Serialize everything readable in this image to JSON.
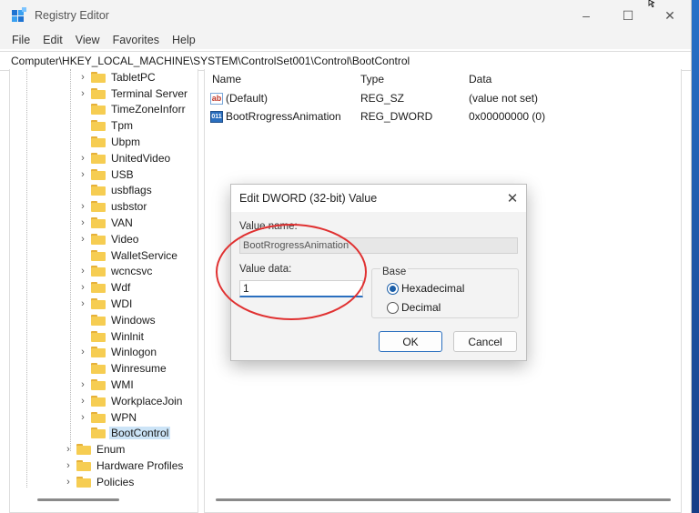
{
  "window": {
    "title": "Registry Editor"
  },
  "menu": [
    "File",
    "Edit",
    "View",
    "Favorites",
    "Help"
  ],
  "address": "Computer\\HKEY_LOCAL_MACHINE\\SYSTEM\\ControlSet001\\Control\\BootControl",
  "tree": [
    {
      "label": "TabletPC",
      "expandable": true
    },
    {
      "label": "Terminal Server",
      "expandable": true
    },
    {
      "label": "TimeZoneInforr",
      "expandable": false
    },
    {
      "label": "Tpm",
      "expandable": false
    },
    {
      "label": "Ubpm",
      "expandable": false
    },
    {
      "label": "UnitedVideo",
      "expandable": true
    },
    {
      "label": "USB",
      "expandable": true
    },
    {
      "label": "usbflags",
      "expandable": false
    },
    {
      "label": "usbstor",
      "expandable": true
    },
    {
      "label": "VAN",
      "expandable": true
    },
    {
      "label": "Video",
      "expandable": true
    },
    {
      "label": "WalletService",
      "expandable": false
    },
    {
      "label": "wcncsvc",
      "expandable": true
    },
    {
      "label": "Wdf",
      "expandable": true
    },
    {
      "label": "WDI",
      "expandable": true
    },
    {
      "label": "Windows",
      "expandable": false
    },
    {
      "label": "Winlnit",
      "expandable": false
    },
    {
      "label": "Winlogon",
      "expandable": true
    },
    {
      "label": "Winresume",
      "expandable": false
    },
    {
      "label": "WMI",
      "expandable": true
    },
    {
      "label": "WorkplaceJoin",
      "expandable": true
    },
    {
      "label": "WPN",
      "expandable": true
    },
    {
      "label": "BootControl",
      "expandable": false,
      "selected": true
    },
    {
      "label": "Enum",
      "expandable": true,
      "level": 0
    },
    {
      "label": "Hardware Profiles",
      "expandable": true,
      "level": 0
    },
    {
      "label": "Policies",
      "expandable": true,
      "level": 0
    }
  ],
  "list": {
    "headers": {
      "name": "Name",
      "type": "Type",
      "data": "Data"
    },
    "rows": [
      {
        "icon": "string-value-icon",
        "name": "(Default)",
        "type": "REG_SZ",
        "data": "(value not set)"
      },
      {
        "icon": "dword-value-icon",
        "name": "BootRrogressAnimation",
        "type": "REG_DWORD",
        "data": "0x00000000 (0)"
      }
    ]
  },
  "dialog": {
    "title": "Edit DWORD (32-bit) Value",
    "value_name_label": "Value name:",
    "value_name": "BootRrogressAnimation",
    "value_data_label": "Value data:",
    "value_data": "1",
    "base_label": "Base",
    "hex_label": "Hexadecimal",
    "dec_label": "Decimal",
    "base_selected": "Hexadecimal",
    "ok_label": "OK",
    "cancel_label": "Cancel"
  },
  "colors": {
    "accent": "#2a6fbf",
    "annotation": "#e03131",
    "selection": "#cce4f7"
  }
}
